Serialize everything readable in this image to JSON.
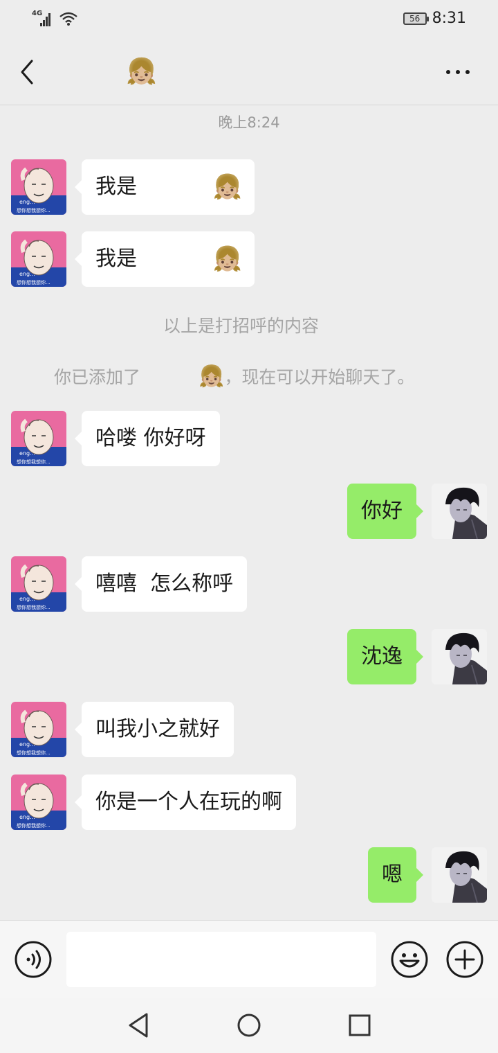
{
  "status_bar": {
    "network": "4G",
    "battery": "56",
    "time": "8:31"
  },
  "header": {
    "title_emoji": "👧🏼",
    "icons": {
      "back": "back-arrow-icon",
      "more": "more-dots-icon"
    }
  },
  "chat": {
    "time_divider": "晚上8:24",
    "greeting_msgs": [
      {
        "text": "我是",
        "emoji": "👧🏼"
      },
      {
        "text": "我是",
        "emoji": "👧🏼"
      }
    ],
    "greeting_notice": "以上是打招呼的内容",
    "added_notice": {
      "before": "你已添加了",
      "emoji": "👧🏼",
      "after": "，现在可以开始聊天了。"
    },
    "messages": [
      {
        "from": "them",
        "text": "哈喽 你好呀"
      },
      {
        "from": "me",
        "text": "你好"
      },
      {
        "from": "them",
        "text": "嘻嘻  怎么称呼"
      },
      {
        "from": "me",
        "text": "沈逸"
      },
      {
        "from": "them",
        "text": "叫我小之就好"
      },
      {
        "from": "them",
        "text": "你是一个人在玩的啊"
      },
      {
        "from": "me",
        "text": "嗯"
      }
    ],
    "avatars": {
      "them_caption": "eng...",
      "them_subcaption": "想你想我想你..."
    }
  },
  "input_bar": {
    "placeholder": "",
    "value": "",
    "icons": {
      "voice": "voice-icon",
      "emoji": "emoji-smile-icon",
      "plus": "plus-circle-icon"
    }
  },
  "nav_bar": {
    "icons": [
      "nav-back-icon",
      "nav-home-icon",
      "nav-recents-icon"
    ]
  },
  "colors": {
    "background": "#ededed",
    "bubble_me": "#95ec69",
    "bubble_them": "#ffffff",
    "meta_text": "#9a9a9a"
  }
}
